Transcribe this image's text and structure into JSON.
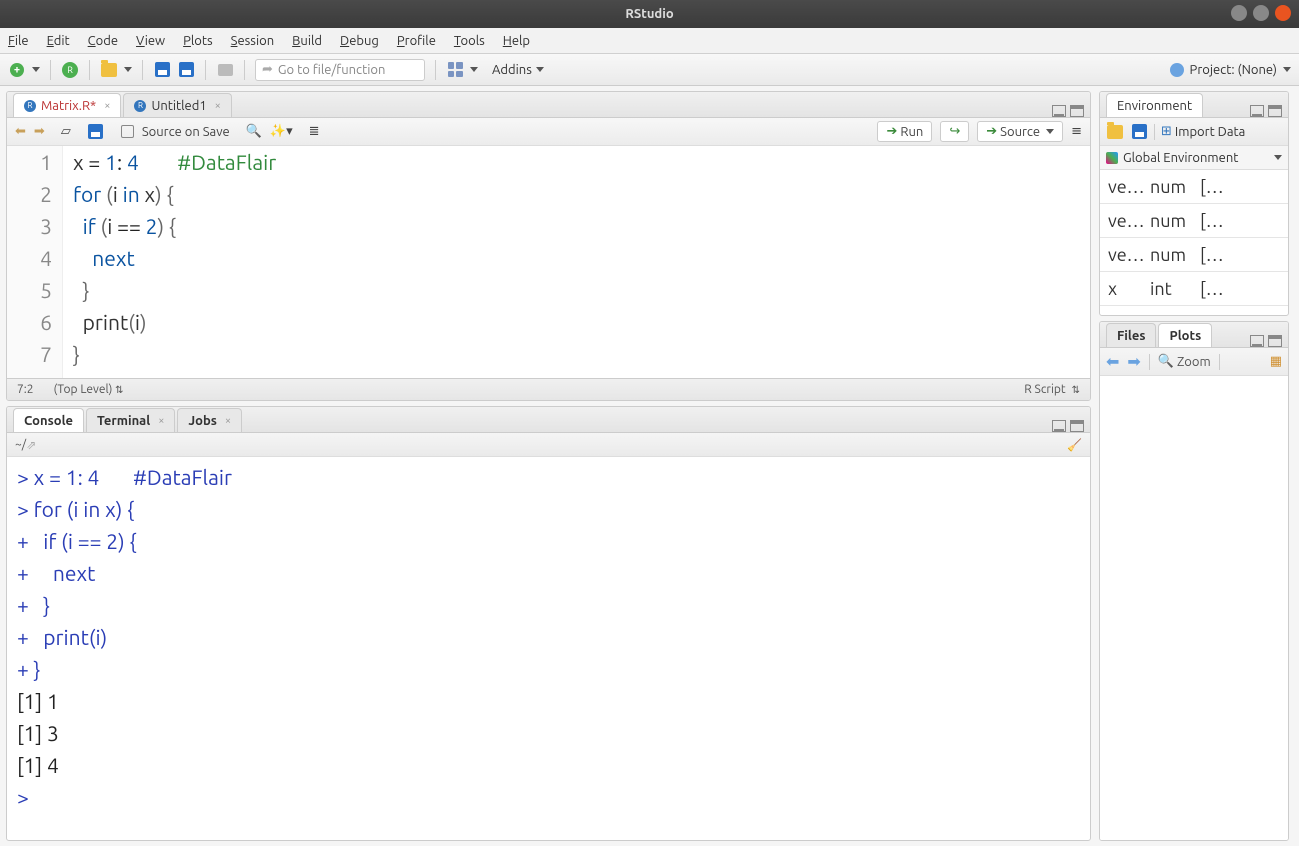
{
  "window": {
    "title": "RStudio"
  },
  "menu": [
    "File",
    "Edit",
    "Code",
    "View",
    "Plots",
    "Session",
    "Build",
    "Debug",
    "Profile",
    "Tools",
    "Help"
  ],
  "toolbar": {
    "goto_placeholder": "Go to file/function",
    "addins": "Addins",
    "project": "Project: (None)"
  },
  "editor": {
    "tabs": [
      {
        "label": "Matrix.R*",
        "active": true
      },
      {
        "label": "Untitled1",
        "active": false
      }
    ],
    "source_on_save": "Source on Save",
    "run_label": "Run",
    "source_label": "Source",
    "code": {
      "lines": [
        {
          "n": "1",
          "raw": "x = 1: 4        #DataFlair",
          "html": "x <span class='tok-op'>=</span> <span class='tok-num'>1</span><span class='tok-op'>:</span> <span class='tok-num'>4</span>        <span class='tok-comment'>#DataFlair</span>"
        },
        {
          "n": "2",
          "raw": "for (i in x) {",
          "html": "<span class='tok-kw'>for</span> <span class='tok-paren'>(</span>i <span class='tok-kw'>in</span> x<span class='tok-paren'>)</span> <span class='tok-paren'>{</span>"
        },
        {
          "n": "3",
          "raw": "  if (i == 2) {",
          "html": "  <span class='tok-kw'>if</span> <span class='tok-paren'>(</span>i <span class='tok-op'>==</span> <span class='tok-num'>2</span><span class='tok-paren'>)</span> <span class='tok-paren'>{</span>"
        },
        {
          "n": "4",
          "raw": "    next",
          "html": "    <span class='tok-kw'>next</span>"
        },
        {
          "n": "5",
          "raw": "  }",
          "html": "  <span class='tok-paren'>}</span>"
        },
        {
          "n": "6",
          "raw": "  print(i)",
          "html": "  print<span class='tok-paren'>(</span>i<span class='tok-paren'>)</span>"
        },
        {
          "n": "7",
          "raw": "}",
          "html": "<span class='tok-paren'>}</span>"
        }
      ]
    },
    "status": {
      "pos": "7:2",
      "scope": "(Top Level)",
      "lang": "R Script"
    }
  },
  "console": {
    "tabs": [
      "Console",
      "Terminal",
      "Jobs"
    ],
    "path": "~/",
    "lines": [
      {
        "cls": "con-code",
        "text": "> x = 1: 4       #DataFlair"
      },
      {
        "cls": "con-code",
        "text": "> for (i in x) {"
      },
      {
        "cls": "con-code",
        "text": "+   if (i == 2) {"
      },
      {
        "cls": "con-code",
        "text": "+     next"
      },
      {
        "cls": "con-code",
        "text": "+   }"
      },
      {
        "cls": "con-code",
        "text": "+   print(i)"
      },
      {
        "cls": "con-code",
        "text": "+ }"
      },
      {
        "cls": "con-out",
        "text": "[1] 1"
      },
      {
        "cls": "con-out",
        "text": "[1] 3"
      },
      {
        "cls": "con-out",
        "text": "[1] 4"
      },
      {
        "cls": "con-code",
        "text": "> "
      }
    ]
  },
  "environment": {
    "tab": "Environment",
    "import": "Import Data",
    "scope": "Global Environment",
    "rows": [
      {
        "name": "ve…",
        "type": "num",
        "val": "[…"
      },
      {
        "name": "ve…",
        "type": "num",
        "val": "[…"
      },
      {
        "name": "ve…",
        "type": "num",
        "val": "[…"
      },
      {
        "name": "x",
        "type": "int",
        "val": "[…"
      }
    ]
  },
  "plots": {
    "tabs": [
      "Files",
      "Plots"
    ],
    "zoom": "Zoom"
  }
}
